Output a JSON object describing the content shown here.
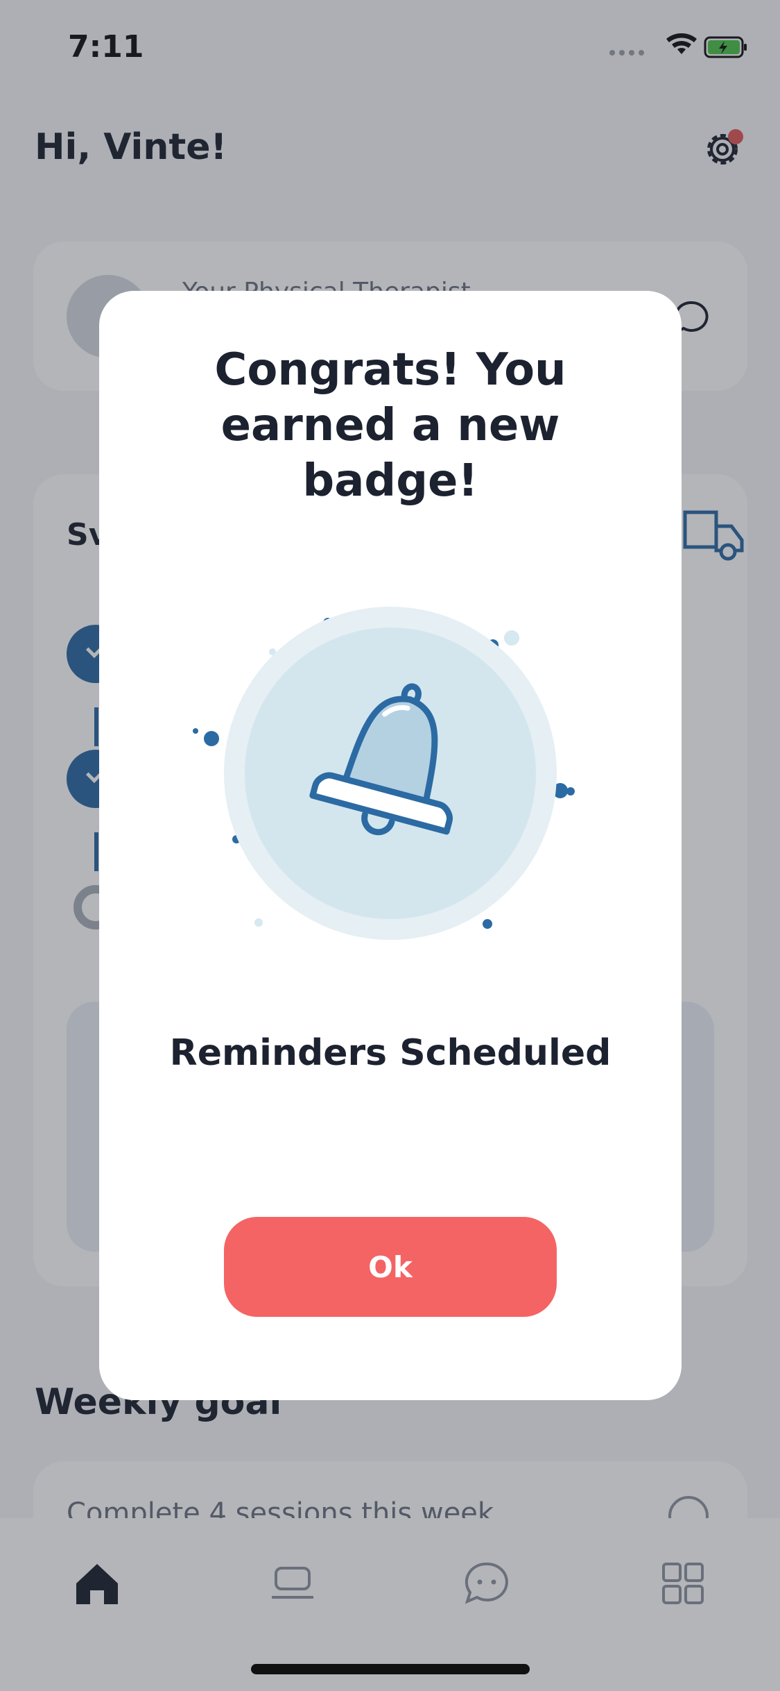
{
  "status_bar": {
    "time": "7:11"
  },
  "header": {
    "greeting": "Hi, Vinte!"
  },
  "therapist_card": {
    "label": "Your Physical Therapist"
  },
  "plan_card": {
    "title_partial": "Sv"
  },
  "weekly_goal": {
    "title": "Weekly goal",
    "goal_text": "Complete 4 sessions this week"
  },
  "tabs": [
    "home-icon",
    "laptop-icon",
    "chat-icon",
    "grid-icon"
  ],
  "modal": {
    "title": "Congrats! You earned a new badge!",
    "badge_icon": "bell-icon",
    "badge_name": "Reminders Scheduled",
    "ok_label": "Ok"
  },
  "colors": {
    "accent_blue": "#2c6aa3",
    "light_blue": "#d6e8f0",
    "button_red": "#f46464",
    "notification_red": "#e05a5a"
  }
}
